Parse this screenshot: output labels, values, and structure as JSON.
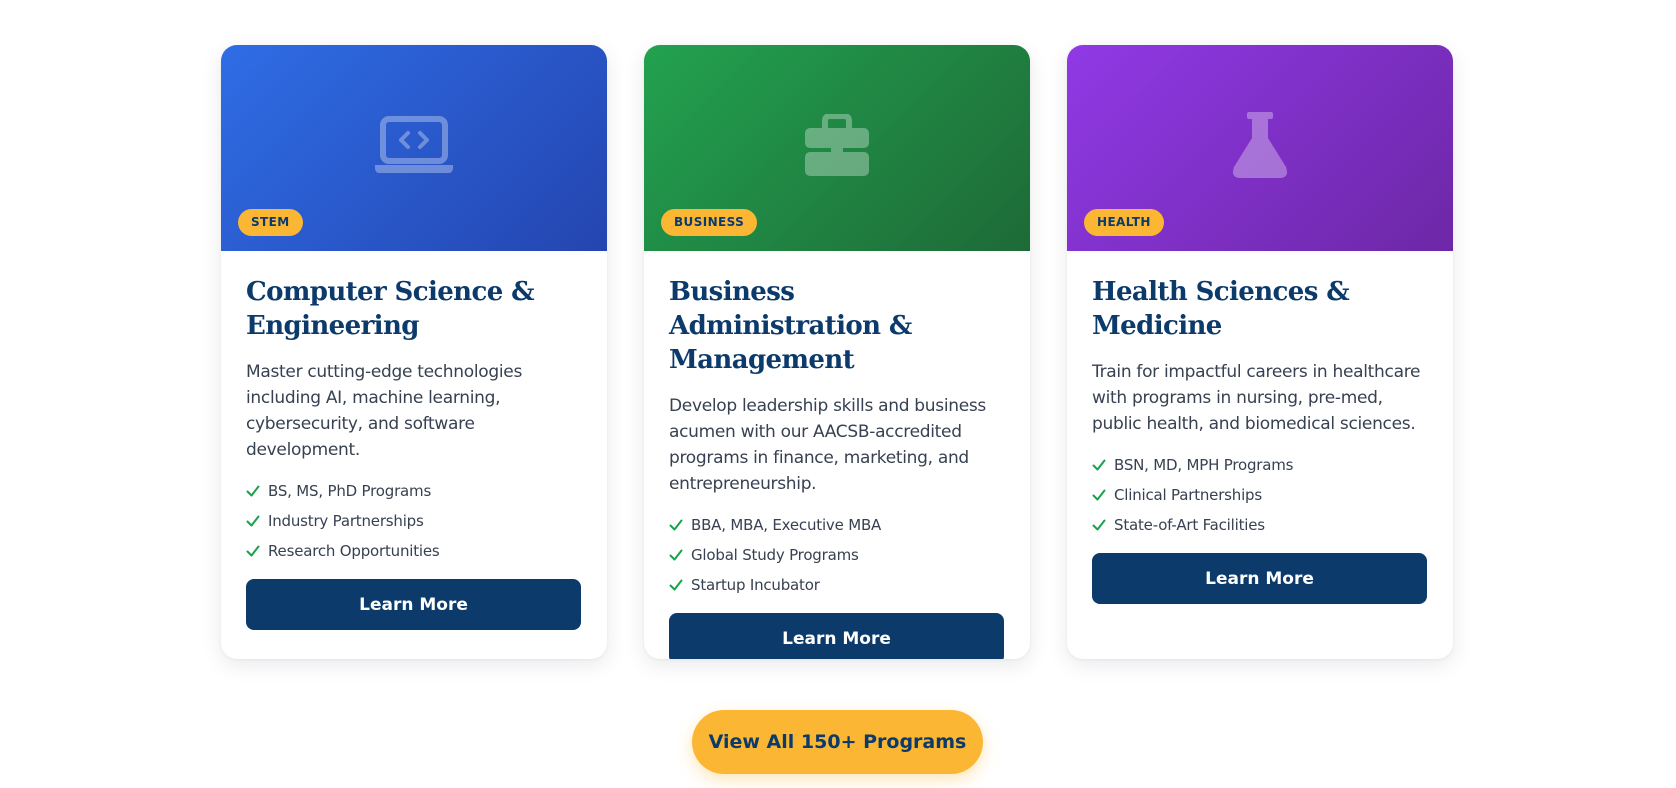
{
  "colors": {
    "navy": "#0b3a6b",
    "gold": "#fbb733",
    "check_green": "#16a34a",
    "stem_gradient": [
      "#2f6de6",
      "#2445b0"
    ],
    "business_gradient": [
      "#22a24f",
      "#1e6a37"
    ],
    "health_gradient": [
      "#9039e6",
      "#6d27a6"
    ]
  },
  "cards": [
    {
      "icon": "laptop-code-icon",
      "badge": "STEM",
      "title": "Computer Science & Engineering",
      "description": "Master cutting-edge technologies including AI, machine learning, cybersecurity, and software development.",
      "features": [
        "BS, MS, PhD Programs",
        "Industry Partnerships",
        "Research Opportunities"
      ],
      "button": "Learn More"
    },
    {
      "icon": "briefcase-icon",
      "badge": "BUSINESS",
      "title": "Business Administration & Management",
      "description": "Develop leadership skills and business acumen with our AACSB-accredited programs in finance, marketing, and entrepreneurship.",
      "features": [
        "BBA, MBA, Executive MBA",
        "Global Study Programs",
        "Startup Incubator"
      ],
      "button": "Learn More"
    },
    {
      "icon": "flask-icon",
      "badge": "HEALTH",
      "title": "Health Sciences & Medicine",
      "description": "Train for impactful careers in healthcare with programs in nursing, pre-med, public health, and biomedical sciences.",
      "features": [
        "BSN, MD, MPH Programs",
        "Clinical Partnerships",
        "State-of-Art Facilities"
      ],
      "button": "Learn More"
    }
  ],
  "view_all_button": "View All 150+ Programs"
}
